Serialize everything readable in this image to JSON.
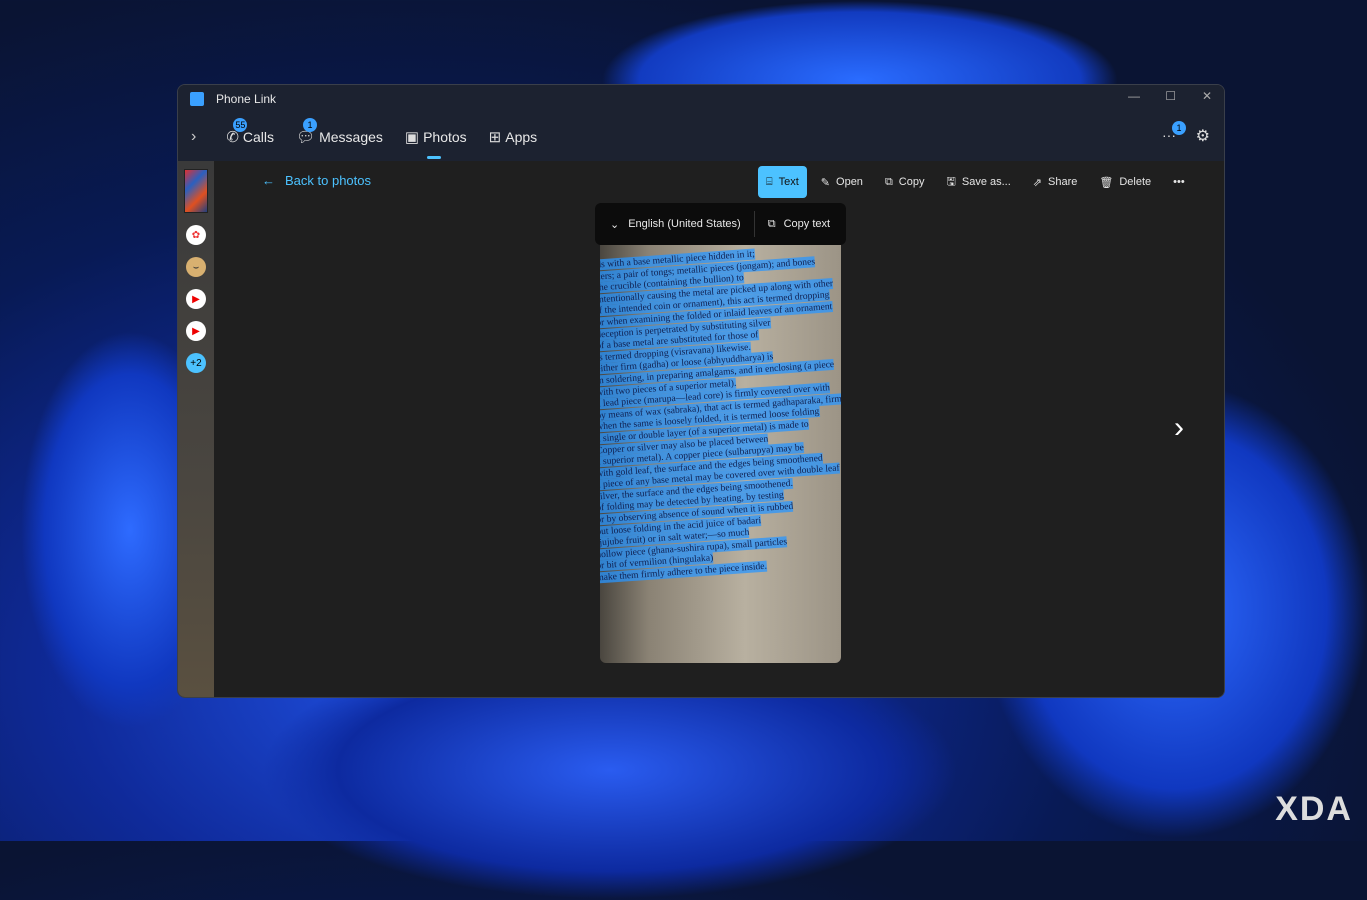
{
  "window": {
    "title": "Phone Link"
  },
  "nav": {
    "items": [
      {
        "label": "Calls",
        "badge": "55",
        "icon": "phone-icon"
      },
      {
        "label": "Messages",
        "badge": "1",
        "icon": "message-icon"
      },
      {
        "label": "Photos",
        "icon": "photo-icon",
        "active": true
      },
      {
        "label": "Apps",
        "icon": "apps-icon"
      }
    ],
    "more_badge": "1"
  },
  "sidebar": {
    "more_label": "+2"
  },
  "main": {
    "back_label": "Back to photos",
    "toolbar": [
      {
        "label": "Text",
        "icon": "text-scan-icon"
      },
      {
        "label": "Open",
        "icon": "open-icon"
      },
      {
        "label": "Copy",
        "icon": "copy-icon"
      },
      {
        "label": "Save as...",
        "icon": "save-icon"
      },
      {
        "label": "Share",
        "icon": "share-icon"
      },
      {
        "label": "Delete",
        "icon": "trash-icon"
      }
    ],
    "popup": {
      "language": "English (United States)",
      "copy_text": "Copy text"
    },
    "photo_lines": [
      "ds with a base metallic piece hidden in it;",
      "cers; a pair of tongs; metallic pieces (jongam); and bones",
      "the crucible (containing the bullion) to",
      "intentionally causing the metal are picked up along with other",
      "if the intended coin or ornament), this act is termed dropping",
      "or when examining the folded or inlaid leaves of an ornament",
      "deception is perpetrated by substituting silver",
      "of a base metal are substituted for those of",
      "is termed dropping (visravana) likewise.",
      "either firm (gadha) or loose (abhyuddharya) is",
      "in soldering, in preparing amalgams, and in enclosing (a piece",
      "with two pieces of a superior metal).",
      "a lead piece (marupa—lead core) is firmly covered over with",
      "by means of wax (sabraka), that act is termed gadhaparaka, firm",
      "when the same is loosely folded, it is termed loose folding",
      "a single or double layer (of a superior metal) is made to",
      "Copper or silver may also be placed between",
      "a superior metal). A copper piece (sulbarupya) may be",
      "with gold leaf, the surface and the edges being smoothened",
      "a piece of any base metal may be covered over with double leaf",
      "silver, the surface and the edges being smoothened.",
      "of folding may be detected by heating, by testing",
      "or by observing absence of sound when it is rubbed",
      "out loose folding in the acid juice of badari",
      "(jujube fruit) or in salt water;—so much",
      "hollow piece (ghana-sushira rupa), small particles",
      "or bit of vermilion (hingulaka)",
      "make them firmly adhere to the piece inside."
    ],
    "next_label": "›"
  },
  "watermark": "XDA"
}
